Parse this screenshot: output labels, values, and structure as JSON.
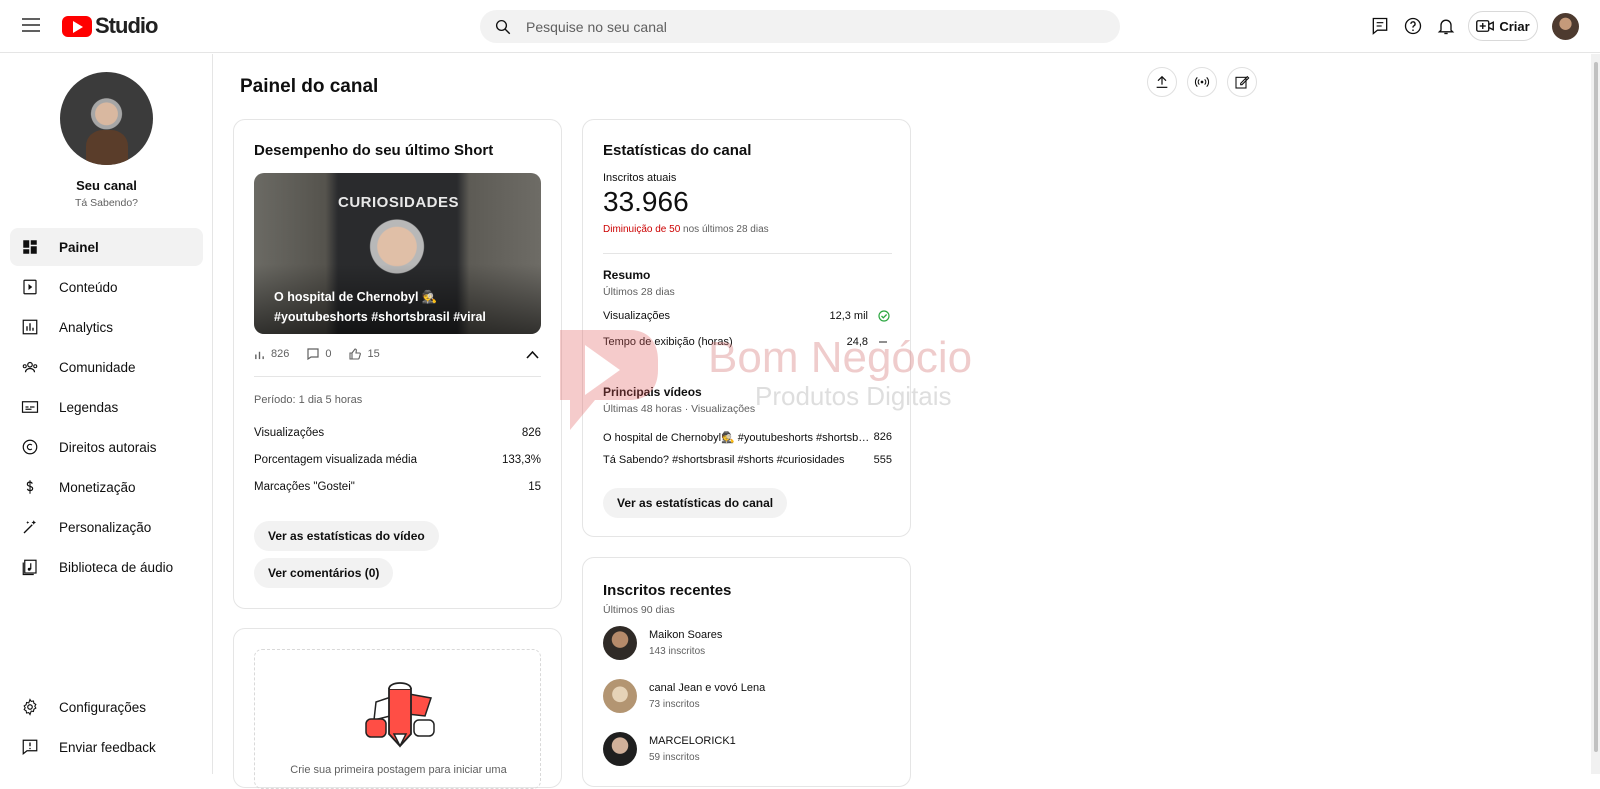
{
  "header": {
    "logo_text": "Studio",
    "search_placeholder": "Pesquise no seu canal",
    "create_label": "Criar"
  },
  "sidebar": {
    "channel_name": "Seu canal",
    "channel_handle": "Tá Sabendo?",
    "items": [
      {
        "label": "Painel",
        "icon": "dashboard-icon",
        "active": true
      },
      {
        "label": "Conteúdo",
        "icon": "content-icon"
      },
      {
        "label": "Analytics",
        "icon": "analytics-icon"
      },
      {
        "label": "Comunidade",
        "icon": "community-icon"
      },
      {
        "label": "Legendas",
        "icon": "subtitles-icon"
      },
      {
        "label": "Direitos autorais",
        "icon": "copyright-icon"
      },
      {
        "label": "Monetização",
        "icon": "monetization-icon"
      },
      {
        "label": "Personalização",
        "icon": "customization-icon"
      },
      {
        "label": "Biblioteca de áudio",
        "icon": "audio-library-icon"
      }
    ],
    "bottom_items": [
      {
        "label": "Configurações",
        "icon": "settings-icon"
      },
      {
        "label": "Enviar feedback",
        "icon": "feedback-icon"
      }
    ]
  },
  "page": {
    "title": "Painel do canal"
  },
  "short_card": {
    "title": "Desempenho do seu último Short",
    "thumbnail_word": "CURIOSIDADES",
    "video_title": "O hospital de Chernobyl 🕵️ #youtubeshorts #shortsbrasil #viral",
    "views": "826",
    "comments": "0",
    "likes": "15",
    "period": "Período: 1 dia 5 horas",
    "metrics": [
      {
        "label": "Visualizações",
        "value": "826"
      },
      {
        "label": "Porcentagem visualizada média",
        "value": "133,3%"
      },
      {
        "label": "Marcações \"Gostei\"",
        "value": "15"
      }
    ],
    "btn_stats": "Ver as estatísticas do vídeo",
    "btn_comments": "Ver comentários (0)"
  },
  "post_card": {
    "text": "Crie sua primeira postagem para iniciar uma"
  },
  "stats_card": {
    "title": "Estatísticas do canal",
    "subs_label": "Inscritos atuais",
    "subs_value": "33.966",
    "change_red": "Diminuição de 50",
    "change_rest": "nos últimos 28 dias",
    "summary_title": "Resumo",
    "summary_period": "Últimos 28 dias",
    "summary_rows": [
      {
        "label": "Visualizações",
        "value": "12,3 mil"
      },
      {
        "label": "Tempo de exibição (horas)",
        "value": "24,8"
      }
    ],
    "top_title": "Principais vídeos",
    "top_period": "Últimas 48 horas · Visualizações",
    "top_videos": [
      {
        "title": "O hospital de Chernobyl🕵️ #youtubeshorts #shortsb…",
        "value": "826"
      },
      {
        "title": "Tá Sabendo? #shortsbrasil #shorts #curiosidades",
        "value": "555"
      }
    ],
    "btn": "Ver as estatísticas do canal"
  },
  "recent_subs": {
    "title": "Inscritos recentes",
    "period": "Últimos 90 dias",
    "items": [
      {
        "name": "Maikon Soares",
        "count": "143 inscritos"
      },
      {
        "name": "canal Jean e vovó Lena",
        "count": "73 inscritos"
      },
      {
        "name": "MARCELORICK1",
        "count": "59 inscritos"
      }
    ]
  },
  "watermark": {
    "line1": "Bom Negócio",
    "line2": "Produtos Digitais"
  },
  "colors": {
    "accent_red": "#ff0000",
    "decrease_red": "#cc0000",
    "check_green": "#2ba640"
  }
}
